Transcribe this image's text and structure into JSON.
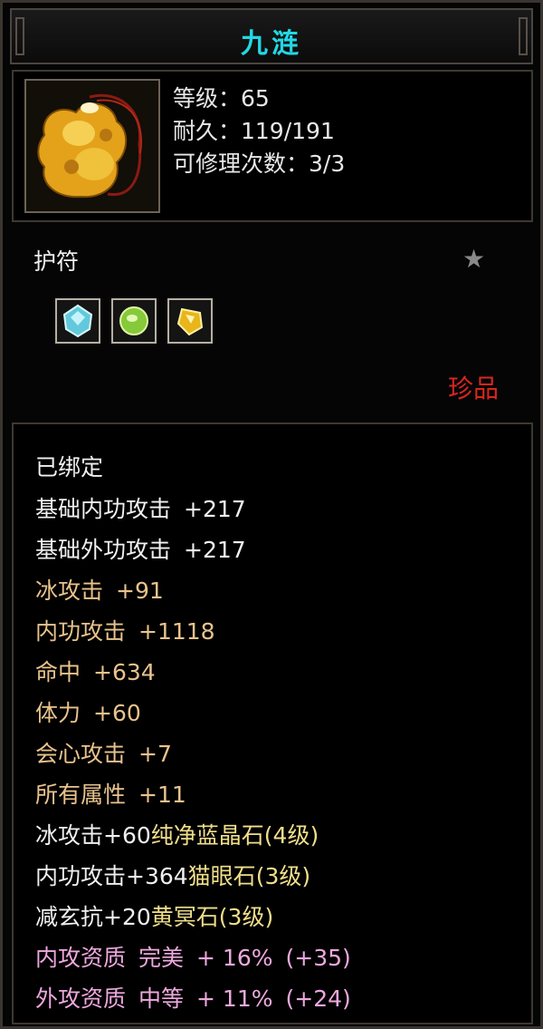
{
  "title": "九涟",
  "stats": {
    "level": "等级：65",
    "durability": "耐久：119/191",
    "repair": "可修理次数：3/3"
  },
  "item_type": "护符",
  "star_icon": "★",
  "rarity": "珍品",
  "bound": "已绑定",
  "attributes": [
    {
      "name": "基础内功攻击",
      "value": "+217"
    },
    {
      "name": "基础外功攻击",
      "value": "+217"
    },
    {
      "name": "冰攻击",
      "value": "+91"
    },
    {
      "name": "内功攻击",
      "value": "+1118"
    },
    {
      "name": "命中",
      "value": "+634"
    },
    {
      "name": "体力",
      "value": "+60"
    },
    {
      "name": "会心攻击",
      "value": "+7"
    },
    {
      "name": "所有属性",
      "value": "+11"
    }
  ],
  "gems": [
    {
      "effect": "冰攻击+60",
      "name": "纯净蓝晶石",
      "level": "(4级)",
      "color": "#5ec9d8"
    },
    {
      "effect": "内功攻击+364",
      "name": "猫眼石",
      "level": "(3级)",
      "color": "#8ccf3a"
    },
    {
      "effect": "减玄抗+20",
      "name": "黄冥石",
      "level": "(3级)",
      "color": "#e6b21a"
    }
  ],
  "qualities": [
    {
      "name": "内攻资质",
      "grade": "完美",
      "pct": "+ 16%",
      "bonus": "(+35)"
    },
    {
      "name": "外攻资质",
      "grade": "中等",
      "pct": "+ 11%",
      "bonus": "(+24)"
    }
  ]
}
